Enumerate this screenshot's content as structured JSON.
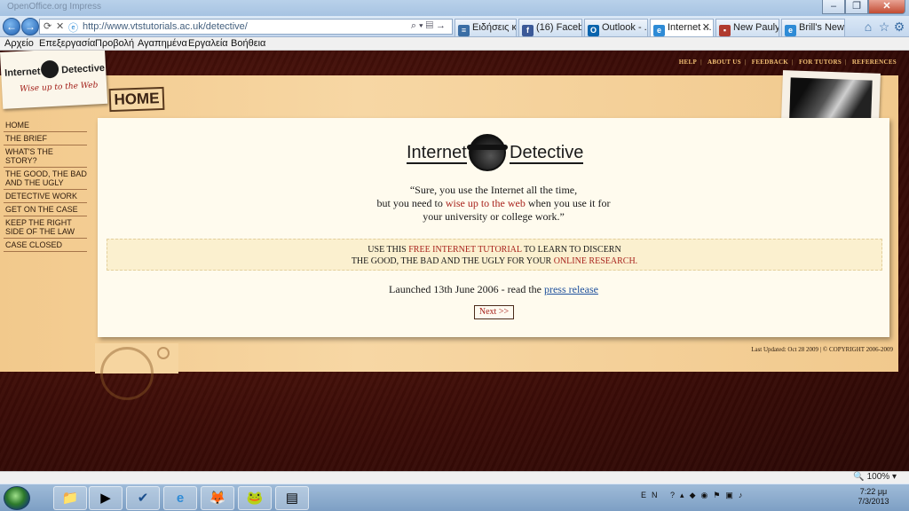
{
  "browser": {
    "title_ghost": "OpenOffice.org Impress",
    "url": "http://www.vtstutorials.ac.uk/detective/",
    "tabs": [
      {
        "label": "Ειδήσεις κ...",
        "icon": "news-icon",
        "color": "#3b6ea5"
      },
      {
        "label": "(16) Faceb...",
        "icon": "facebook-icon",
        "color": "#3b5998"
      },
      {
        "label": "Outlook - ...",
        "icon": "outlook-icon",
        "color": "#0a64ad"
      },
      {
        "label": "Internet ...",
        "icon": "ie-page-icon",
        "color": "#2e8bd6"
      },
      {
        "label": "New Pauly ...",
        "icon": "page-icon",
        "color": "#b03a2e"
      },
      {
        "label": "Brill's New ...",
        "icon": "ie-page-icon",
        "color": "#2e8bd6"
      }
    ],
    "active_tab": 3,
    "menu": [
      "Αρχείο",
      "Επεξεργασία",
      "Προβολή",
      "Αγαπημένα",
      "Εργαλεία",
      "Βοήθεια"
    ],
    "zoom": "100%"
  },
  "site": {
    "logo_word1": "Internet",
    "logo_word2": "Detective",
    "tagline": "Wise up to the Web",
    "top_links": [
      "HELP",
      "ABOUT US",
      "FEEDBACK",
      "FOR TUTORS",
      "REFERENCES"
    ],
    "section_tag": "HOME",
    "sidebar": [
      "HOME",
      "THE BRIEF",
      "WHAT'S THE STORY?",
      "THE GOOD, THE BAD AND THE UGLY",
      "DETECTIVE WORK",
      "GET ON THE CASE",
      "KEEP THE RIGHT SIDE OF THE LAW",
      "CASE CLOSED"
    ]
  },
  "content": {
    "quote_line1": "“Sure, you use the Internet all the time,",
    "quote_line2_pre": "but you need to ",
    "quote_line2_red": "wise up to the web",
    "quote_line2_post": " when you use it for",
    "quote_line3": "your university or college work.”",
    "banner_l1_pre": "USE THIS ",
    "banner_l1_red": "FREE INTERNET TUTORIAL",
    "banner_l1_post": " TO LEARN TO DISCERN",
    "banner_l2_pre": "THE GOOD, THE BAD AND THE UGLY FOR YOUR ",
    "banner_l2_red": "ONLINE RESEARCH.",
    "launched_text": "Launched 13th June 2006 - read the ",
    "launched_link": "press release",
    "next_label": "Next >>",
    "footer": "Last Updated: Oct 28 2009 |   © COPYRIGHT 2006-2009"
  },
  "taskbar": {
    "apps": [
      {
        "name": "explorer-icon",
        "glyph": "📁"
      },
      {
        "name": "media-player-icon",
        "glyph": "▶"
      },
      {
        "name": "task-app-icon",
        "glyph": "✔"
      },
      {
        "name": "ie-icon",
        "glyph": "e"
      },
      {
        "name": "firefox-icon",
        "glyph": "🦊"
      },
      {
        "name": "frog-app-icon",
        "glyph": "🐸"
      },
      {
        "name": "odf-app-icon",
        "glyph": "▤"
      }
    ],
    "lang": "EN",
    "time": "7:22 μμ",
    "date": "7/3/2013"
  }
}
